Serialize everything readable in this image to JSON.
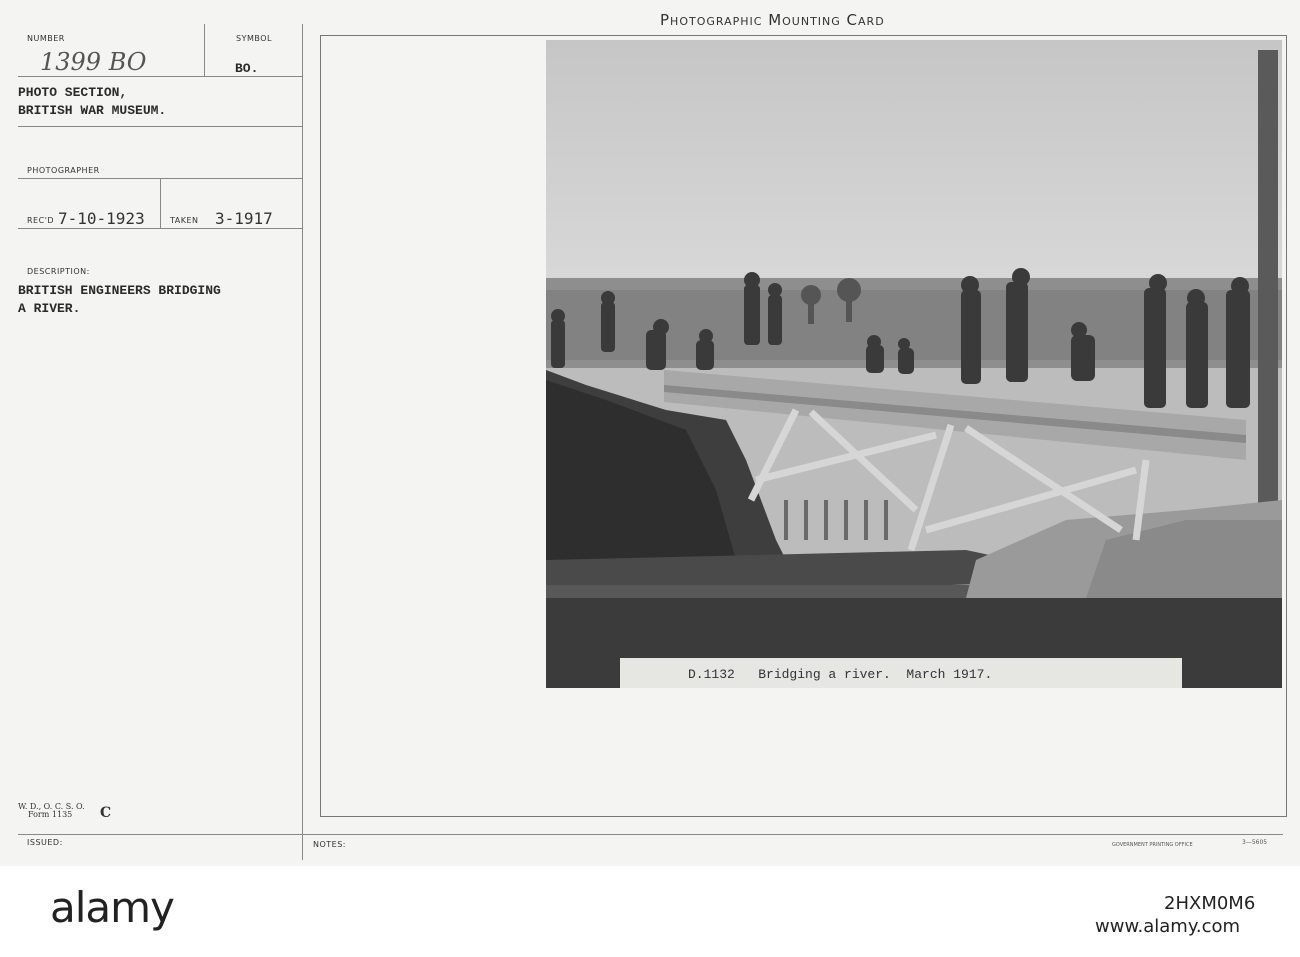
{
  "card": {
    "title": "Photographic Mounting Card",
    "number_label": "NUMBER",
    "number_value": "1399 BO",
    "symbol_label": "SYMBOL",
    "symbol_value": "BO.",
    "section_line1": "PHOTO SECTION,",
    "section_line2": "BRITISH WAR MUSEUM.",
    "photographer_label": "PHOTOGRAPHER",
    "recd_label": "REC'D",
    "recd_value": "7-10-1923",
    "taken_label": "TAKEN",
    "taken_value": "3-1917",
    "description_label": "DESCRIPTION:",
    "description_line1": "BRITISH ENGINEERS BRIDGING",
    "description_line2": "A RIVER.",
    "form_line1": "W. D., O. C. S. O.",
    "form_line2": "Form 1135",
    "form_letter": "C",
    "issued_label": "ISSUED:",
    "notes_label": "NOTES:",
    "printing_office": "GOVERNMENT PRINTING OFFICE",
    "print_code": "3—5605"
  },
  "photo": {
    "caption": "D.1132   Bridging a river.  March 1917."
  },
  "banner": {
    "logo": "alamy",
    "image_id": "2HXM0M6",
    "url": "www.alamy.com"
  }
}
